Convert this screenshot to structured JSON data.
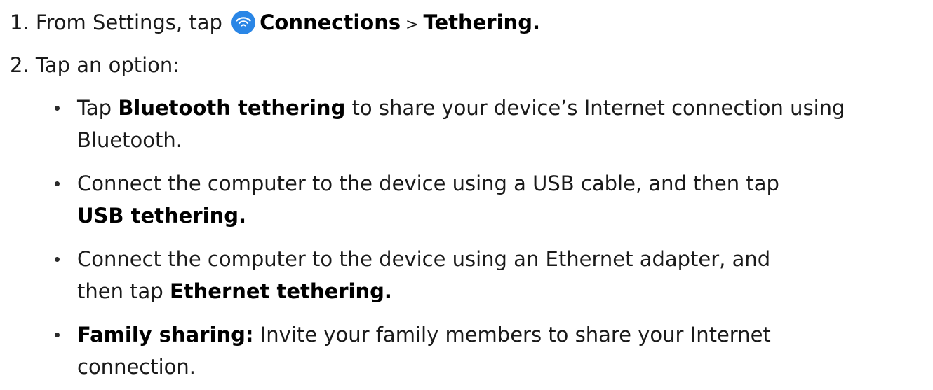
{
  "steps": [
    {
      "number": "1.",
      "text_before_icon": "From Settings, tap",
      "icon": "wifi-icon",
      "icon_color": "#2a86e6",
      "bold_1": "Connections",
      "separator": " > ",
      "bold_2": "Tethering."
    },
    {
      "number": "2.",
      "text": "Tap an option:"
    }
  ],
  "bullets": [
    {
      "line1_pre": "Tap ",
      "line1_bold": "Bluetooth tethering",
      "line1_post": " to share your device’s Internet connection using",
      "line2": "Bluetooth."
    },
    {
      "line1": "Connect the computer to the device using a USB cable, and then tap",
      "line2_bold": "USB tethering."
    },
    {
      "line1": "Connect the computer to the device using an Ethernet adapter, and",
      "line2_pre": "then tap ",
      "line2_bold": "Ethernet tethering."
    },
    {
      "line1_bold": "Family sharing:",
      "line1_post": " Invite your family members to share your Internet",
      "line2": "connection."
    }
  ]
}
